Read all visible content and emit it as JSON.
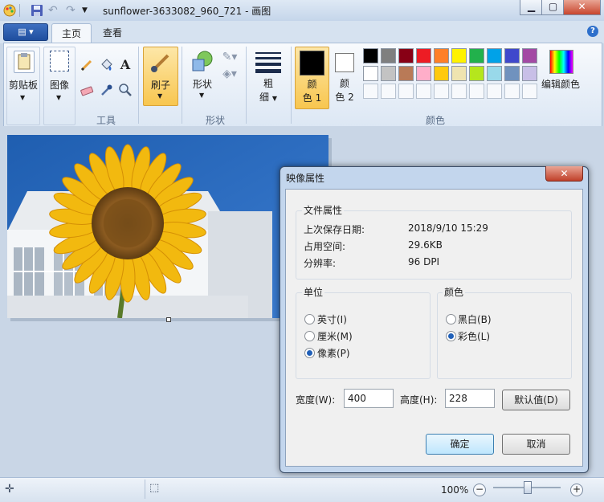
{
  "window": {
    "title": "sunflower-3633082_960_721 - 画图"
  },
  "tabs": {
    "home": "主页",
    "view": "查看"
  },
  "ribbon": {
    "clipboard_label": "剪贴板",
    "image_label": "图像",
    "tools_label": "工具",
    "brushes_label": "刷子",
    "shapes_button_label": "形状",
    "shapes_group_label": "形状",
    "size_label": "粗\n细",
    "size_line1": "粗",
    "size_line2": "细",
    "color1_line1": "颜",
    "color1_line2": "色 1",
    "color2_line1": "颜",
    "color2_line2": "色 2",
    "colors_group_label": "颜色",
    "edit_colors_label": "编辑颜色",
    "help_icon": "?"
  },
  "palette": {
    "row1": [
      "#000000",
      "#7f7f7f",
      "#880015",
      "#ed1c24",
      "#ff7f27",
      "#fff200",
      "#22b14c",
      "#00a2e8",
      "#3f48cc",
      "#a349a4"
    ],
    "row2": [
      "#ffffff",
      "#c3c3c3",
      "#b97a57",
      "#ffaec9",
      "#ffc90e",
      "#efe4b0",
      "#b5e61d",
      "#99d9ea",
      "#7092be",
      "#c8bfe7"
    ],
    "color1": "#000000",
    "color2": "#ffffff"
  },
  "status": {
    "zoom": "100%"
  },
  "dialog": {
    "title": "映像属性",
    "file_props_heading": "文件属性",
    "last_saved_label": "上次保存日期:",
    "last_saved_value": "2018/9/10 15:29",
    "size_label": "占用空间:",
    "size_value": "29.6KB",
    "resolution_label": "分辨率:",
    "resolution_value": "96 DPI",
    "units_heading": "单位",
    "unit_inches": "英寸(I)",
    "unit_cm": "厘米(M)",
    "unit_pixels": "像素(P)",
    "selected_unit": "pixels",
    "colors_heading": "颜色",
    "color_bw": "黑白(B)",
    "color_color": "彩色(L)",
    "selected_color": "color",
    "width_label": "宽度(W):",
    "width_value": "400",
    "height_label": "高度(H):",
    "height_value": "228",
    "default_button": "默认值(D)",
    "ok_button": "确定",
    "cancel_button": "取消"
  }
}
